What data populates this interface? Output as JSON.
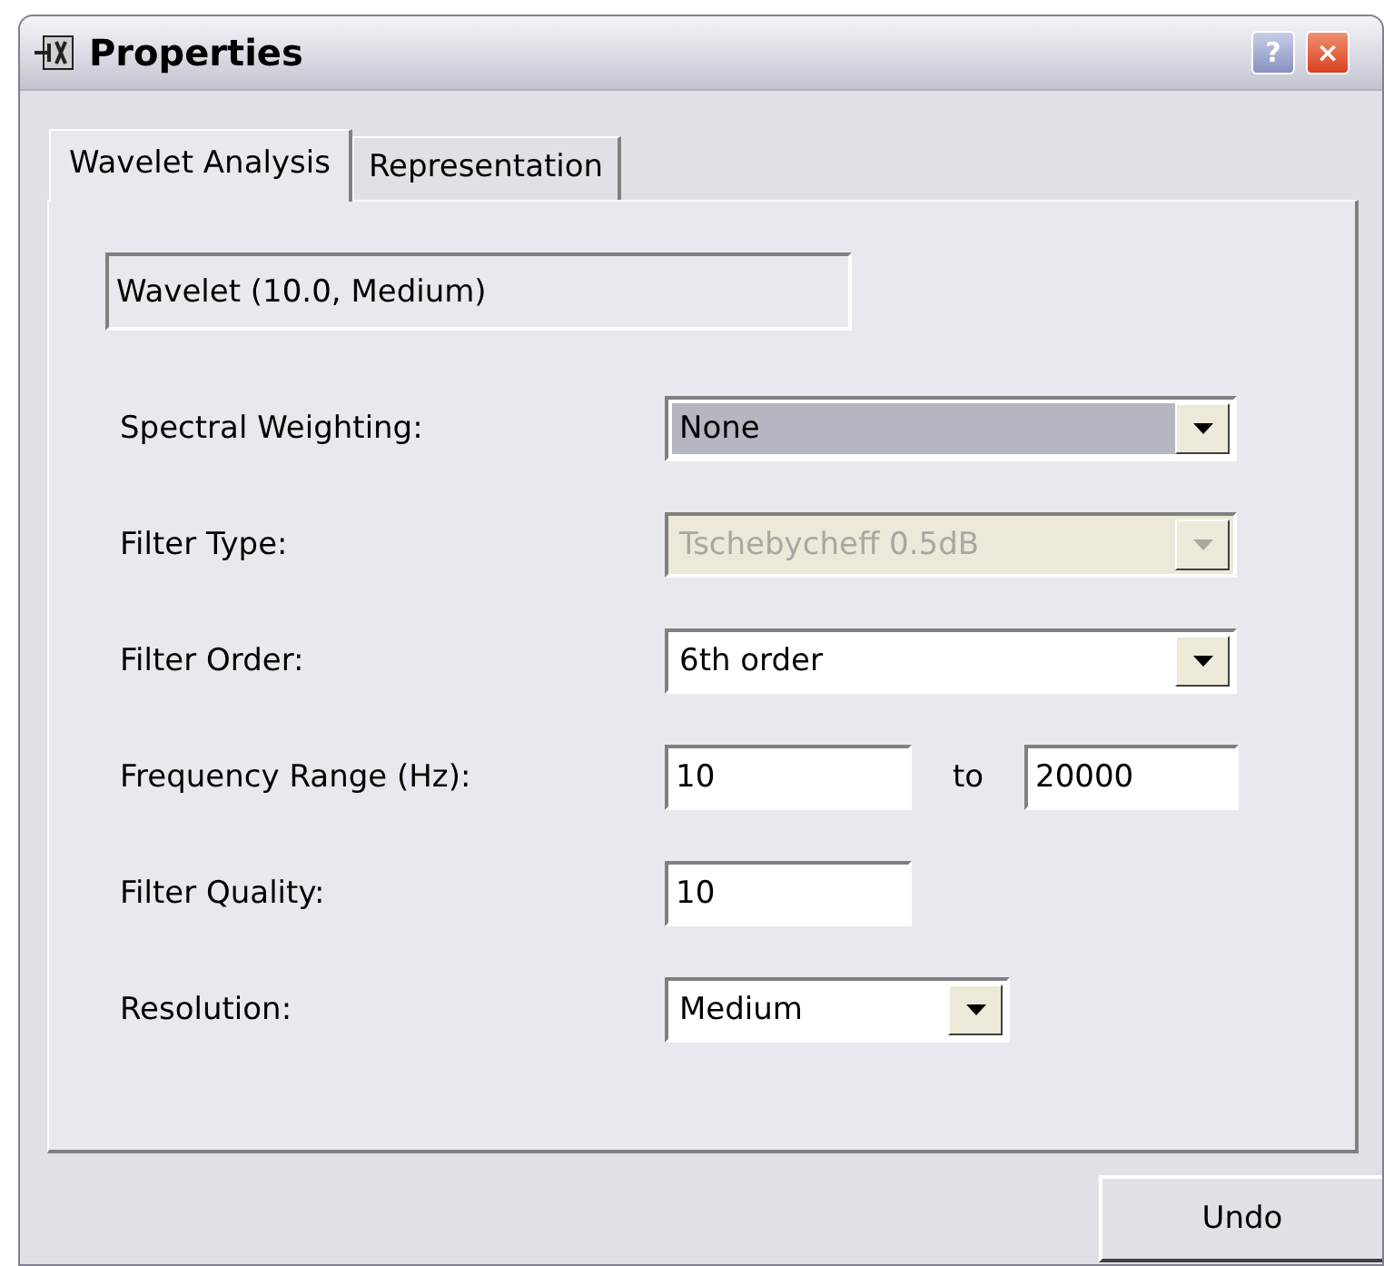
{
  "window": {
    "title": "Properties",
    "buttons": [
      "?",
      "×"
    ]
  },
  "tabs": [
    {
      "label": "Wavelet Analysis",
      "selected": true
    },
    {
      "label": "Representation",
      "selected": false
    }
  ],
  "summary": "Wavelet (10.0, Medium)",
  "rows": [
    {
      "label": "Spectral Weighting:",
      "kind": "combo",
      "value": "None",
      "focused": true,
      "disabled": false
    },
    {
      "label": "Filter Type:",
      "kind": "combo",
      "value": "Tschebycheff 0.5dB",
      "focused": false,
      "disabled": true
    },
    {
      "label": "Filter Order:",
      "kind": "combo",
      "value": "6th order",
      "focused": false,
      "disabled": false
    },
    {
      "label": "Frequency Range (Hz):",
      "kind": "range",
      "from": "10",
      "separator": "to",
      "to": "20000"
    },
    {
      "label": "Filter Quality:",
      "kind": "text",
      "value": "10"
    },
    {
      "label": "Resolution:",
      "kind": "short-combo",
      "value": "Medium",
      "focused": false,
      "disabled": false
    }
  ],
  "buttons": [
    "Undo"
  ]
}
